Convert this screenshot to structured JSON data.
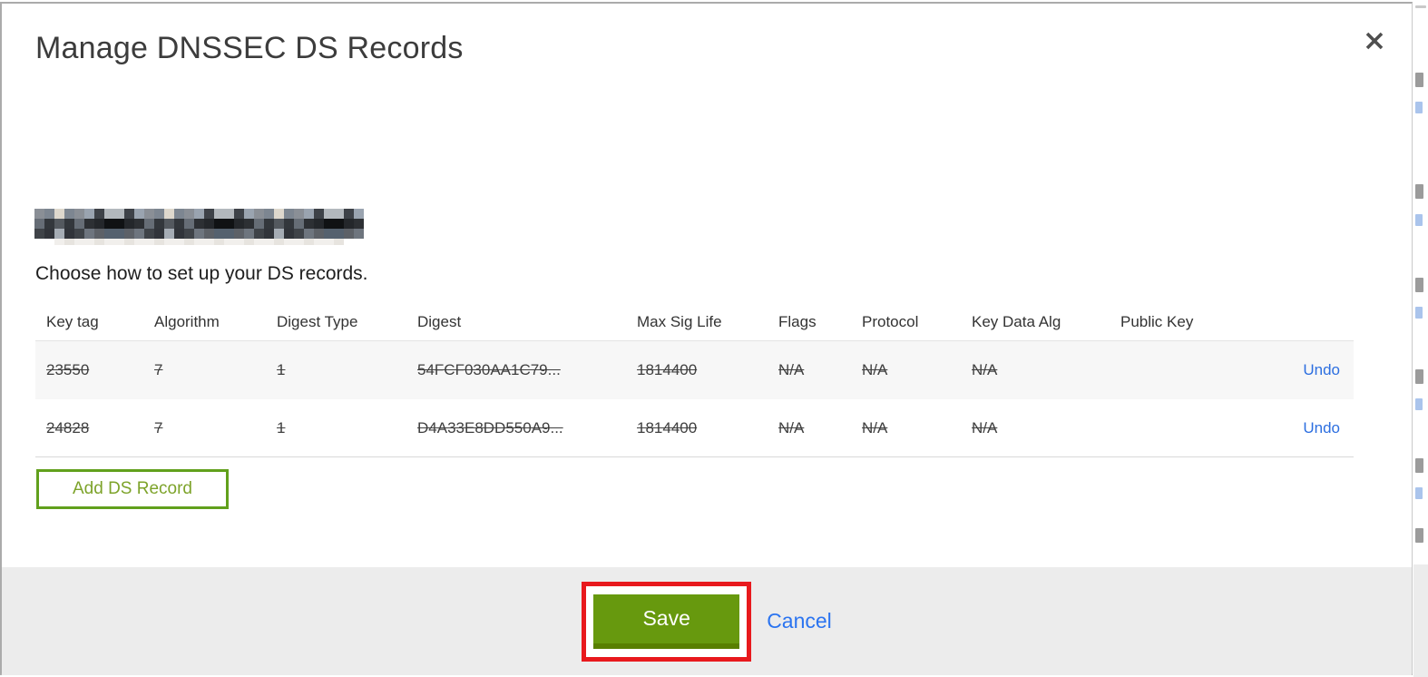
{
  "modal": {
    "title": "Manage DNSSEC DS Records",
    "domain_redacted": true,
    "instruction": "Choose how to set up your DS records."
  },
  "table": {
    "headers": [
      "Key tag",
      "Algorithm",
      "Digest Type",
      "Digest",
      "Max Sig Life",
      "Flags",
      "Protocol",
      "Key Data Alg",
      "Public Key"
    ],
    "rows": [
      {
        "key_tag": "23550",
        "algorithm": "7",
        "digest_type": "1",
        "digest": "54FCF030AA1C79...",
        "max_sig_life": "1814400",
        "flags": "N/A",
        "protocol": "N/A",
        "key_data_alg": "N/A",
        "public_key": "",
        "action": "Undo",
        "marked_deleted": true
      },
      {
        "key_tag": "24828",
        "algorithm": "7",
        "digest_type": "1",
        "digest": "D4A33E8DD550A9...",
        "max_sig_life": "1814400",
        "flags": "N/A",
        "protocol": "N/A",
        "key_data_alg": "N/A",
        "public_key": "",
        "action": "Undo",
        "marked_deleted": true
      }
    ]
  },
  "buttons": {
    "add_record": "Add DS Record",
    "save": "Save",
    "cancel": "Cancel"
  },
  "colors": {
    "save_green": "#67990e",
    "save_green_dark": "#587f00",
    "add_green_border": "#61a01c",
    "add_green_text": "#7da32a",
    "link_blue": "#2d6fe0",
    "annotation_red": "#e8191d",
    "row_stripe": "#f7f7f7",
    "footer_bg": "#ececec"
  }
}
